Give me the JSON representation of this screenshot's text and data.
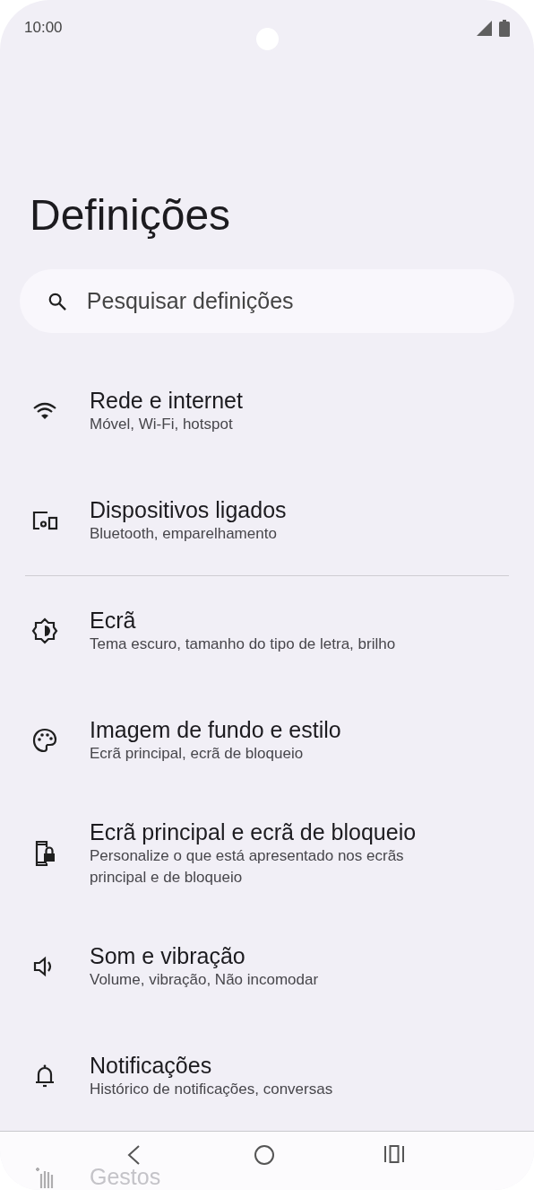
{
  "status_bar": {
    "time": "10:00"
  },
  "title": "Definições",
  "search": {
    "placeholder": "Pesquisar definições"
  },
  "sections": [
    [
      {
        "title": "Rede e internet",
        "subtitle": "Móvel, Wi-Fi, hotspot"
      },
      {
        "title": "Dispositivos ligados",
        "subtitle": "Bluetooth, emparelhamento"
      }
    ],
    [
      {
        "title": "Ecrã",
        "subtitle": "Tema escuro, tamanho do tipo de letra, brilho"
      },
      {
        "title": "Imagem de fundo e estilo",
        "subtitle": "Ecrã principal, ecrã de bloqueio"
      },
      {
        "title": "Ecrã principal e ecrã de bloqueio",
        "subtitle": "Personalize o que está apresentado nos ecrãs principal e de bloqueio"
      },
      {
        "title": "Som e vibração",
        "subtitle": "Volume, vibração, Não incomodar"
      },
      {
        "title": "Notificações",
        "subtitle": "Histórico de notificações, conversas"
      },
      {
        "title": "Gestos"
      }
    ]
  ]
}
